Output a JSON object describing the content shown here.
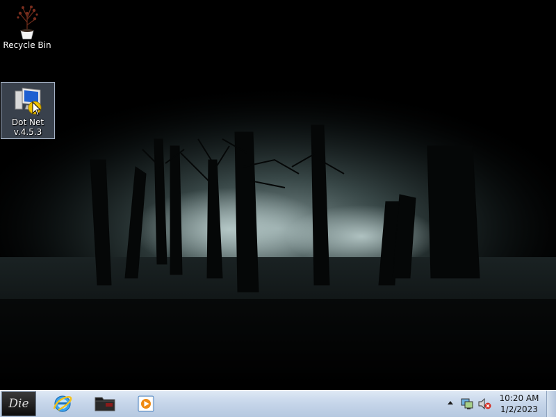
{
  "desktop": {
    "icons": [
      {
        "label": "Recycle Bin",
        "icon": "plant-recycle-bin-icon"
      },
      {
        "label_line1": "Dot Net",
        "label_line2": "v.4.5.3",
        "icon": "computer-installer-icon",
        "selected": true
      }
    ],
    "wallpaper": "misty-dark-forest"
  },
  "taskbar": {
    "start_label": "Die",
    "pinned": [
      {
        "name": "Internet Explorer",
        "icon": "internet-explorer-icon"
      },
      {
        "name": "Folder",
        "icon": "folder-icon"
      },
      {
        "name": "Media Player",
        "icon": "media-player-icon"
      }
    ],
    "tray": {
      "icons": [
        "show-hidden-icons-arrow",
        "network-icon",
        "volume-muted-icon"
      ],
      "time": "10:20 AM",
      "date": "1/2/2023"
    }
  },
  "colors": {
    "taskbar_top": "#dfe9f5",
    "taskbar_bottom": "#b5c8e0",
    "selection": "#96aac8"
  }
}
